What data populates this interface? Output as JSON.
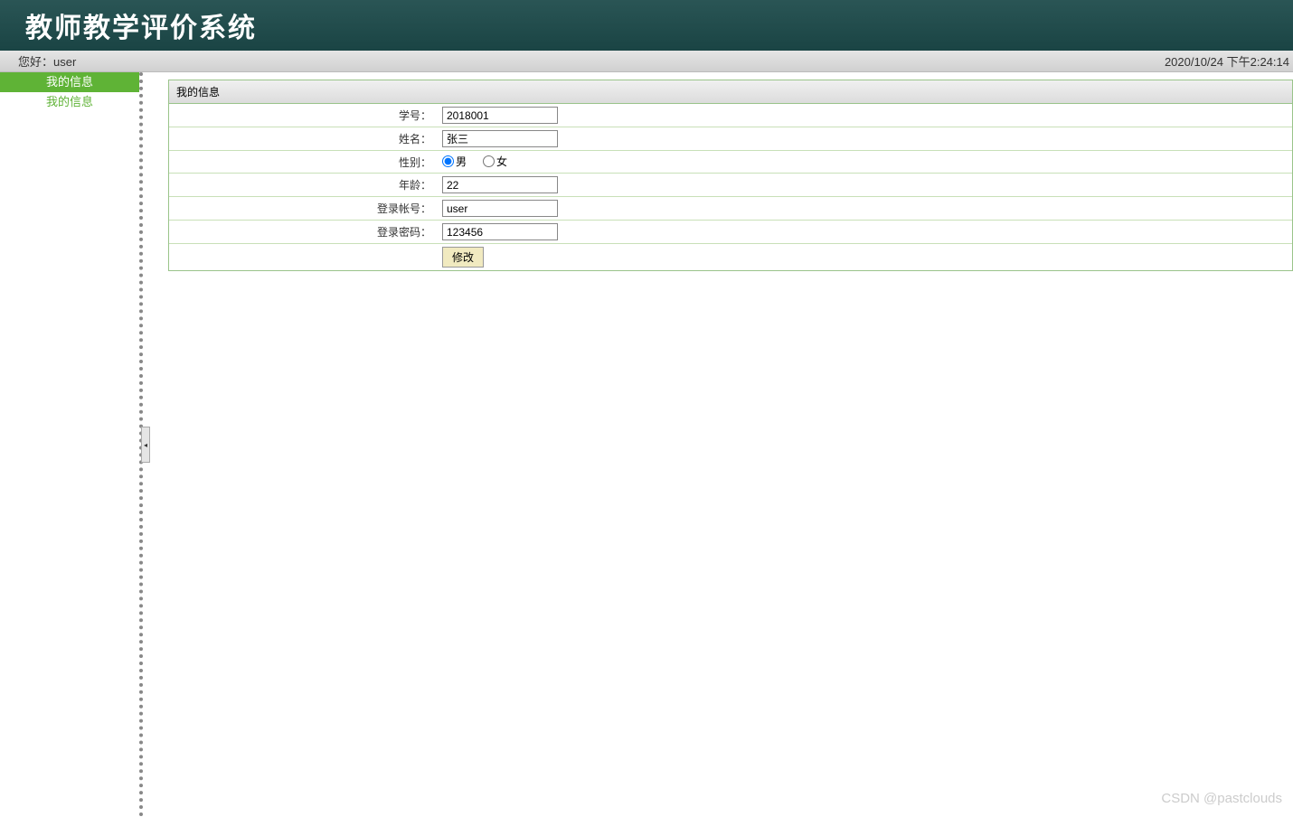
{
  "header": {
    "title": "教师教学评价系统"
  },
  "topbar": {
    "greeting_prefix": "您好：",
    "username": "user",
    "datetime": "2020/10/24 下午2:24:14"
  },
  "sidebar": {
    "items": [
      {
        "label": "我的信息",
        "active": true
      },
      {
        "label": "我的信息",
        "active": false
      }
    ]
  },
  "panel": {
    "title": "我的信息"
  },
  "form": {
    "student_id": {
      "label": "学号：",
      "value": "2018001"
    },
    "name": {
      "label": "姓名：",
      "value": "张三"
    },
    "gender": {
      "label": "性别：",
      "male": "男",
      "female": "女",
      "selected": "male"
    },
    "age": {
      "label": "年龄：",
      "value": "22"
    },
    "account": {
      "label": "登录帐号：",
      "value": "user"
    },
    "password": {
      "label": "登录密码：",
      "value": "123456"
    },
    "submit": "修改"
  },
  "watermark": "CSDN @pastclouds"
}
